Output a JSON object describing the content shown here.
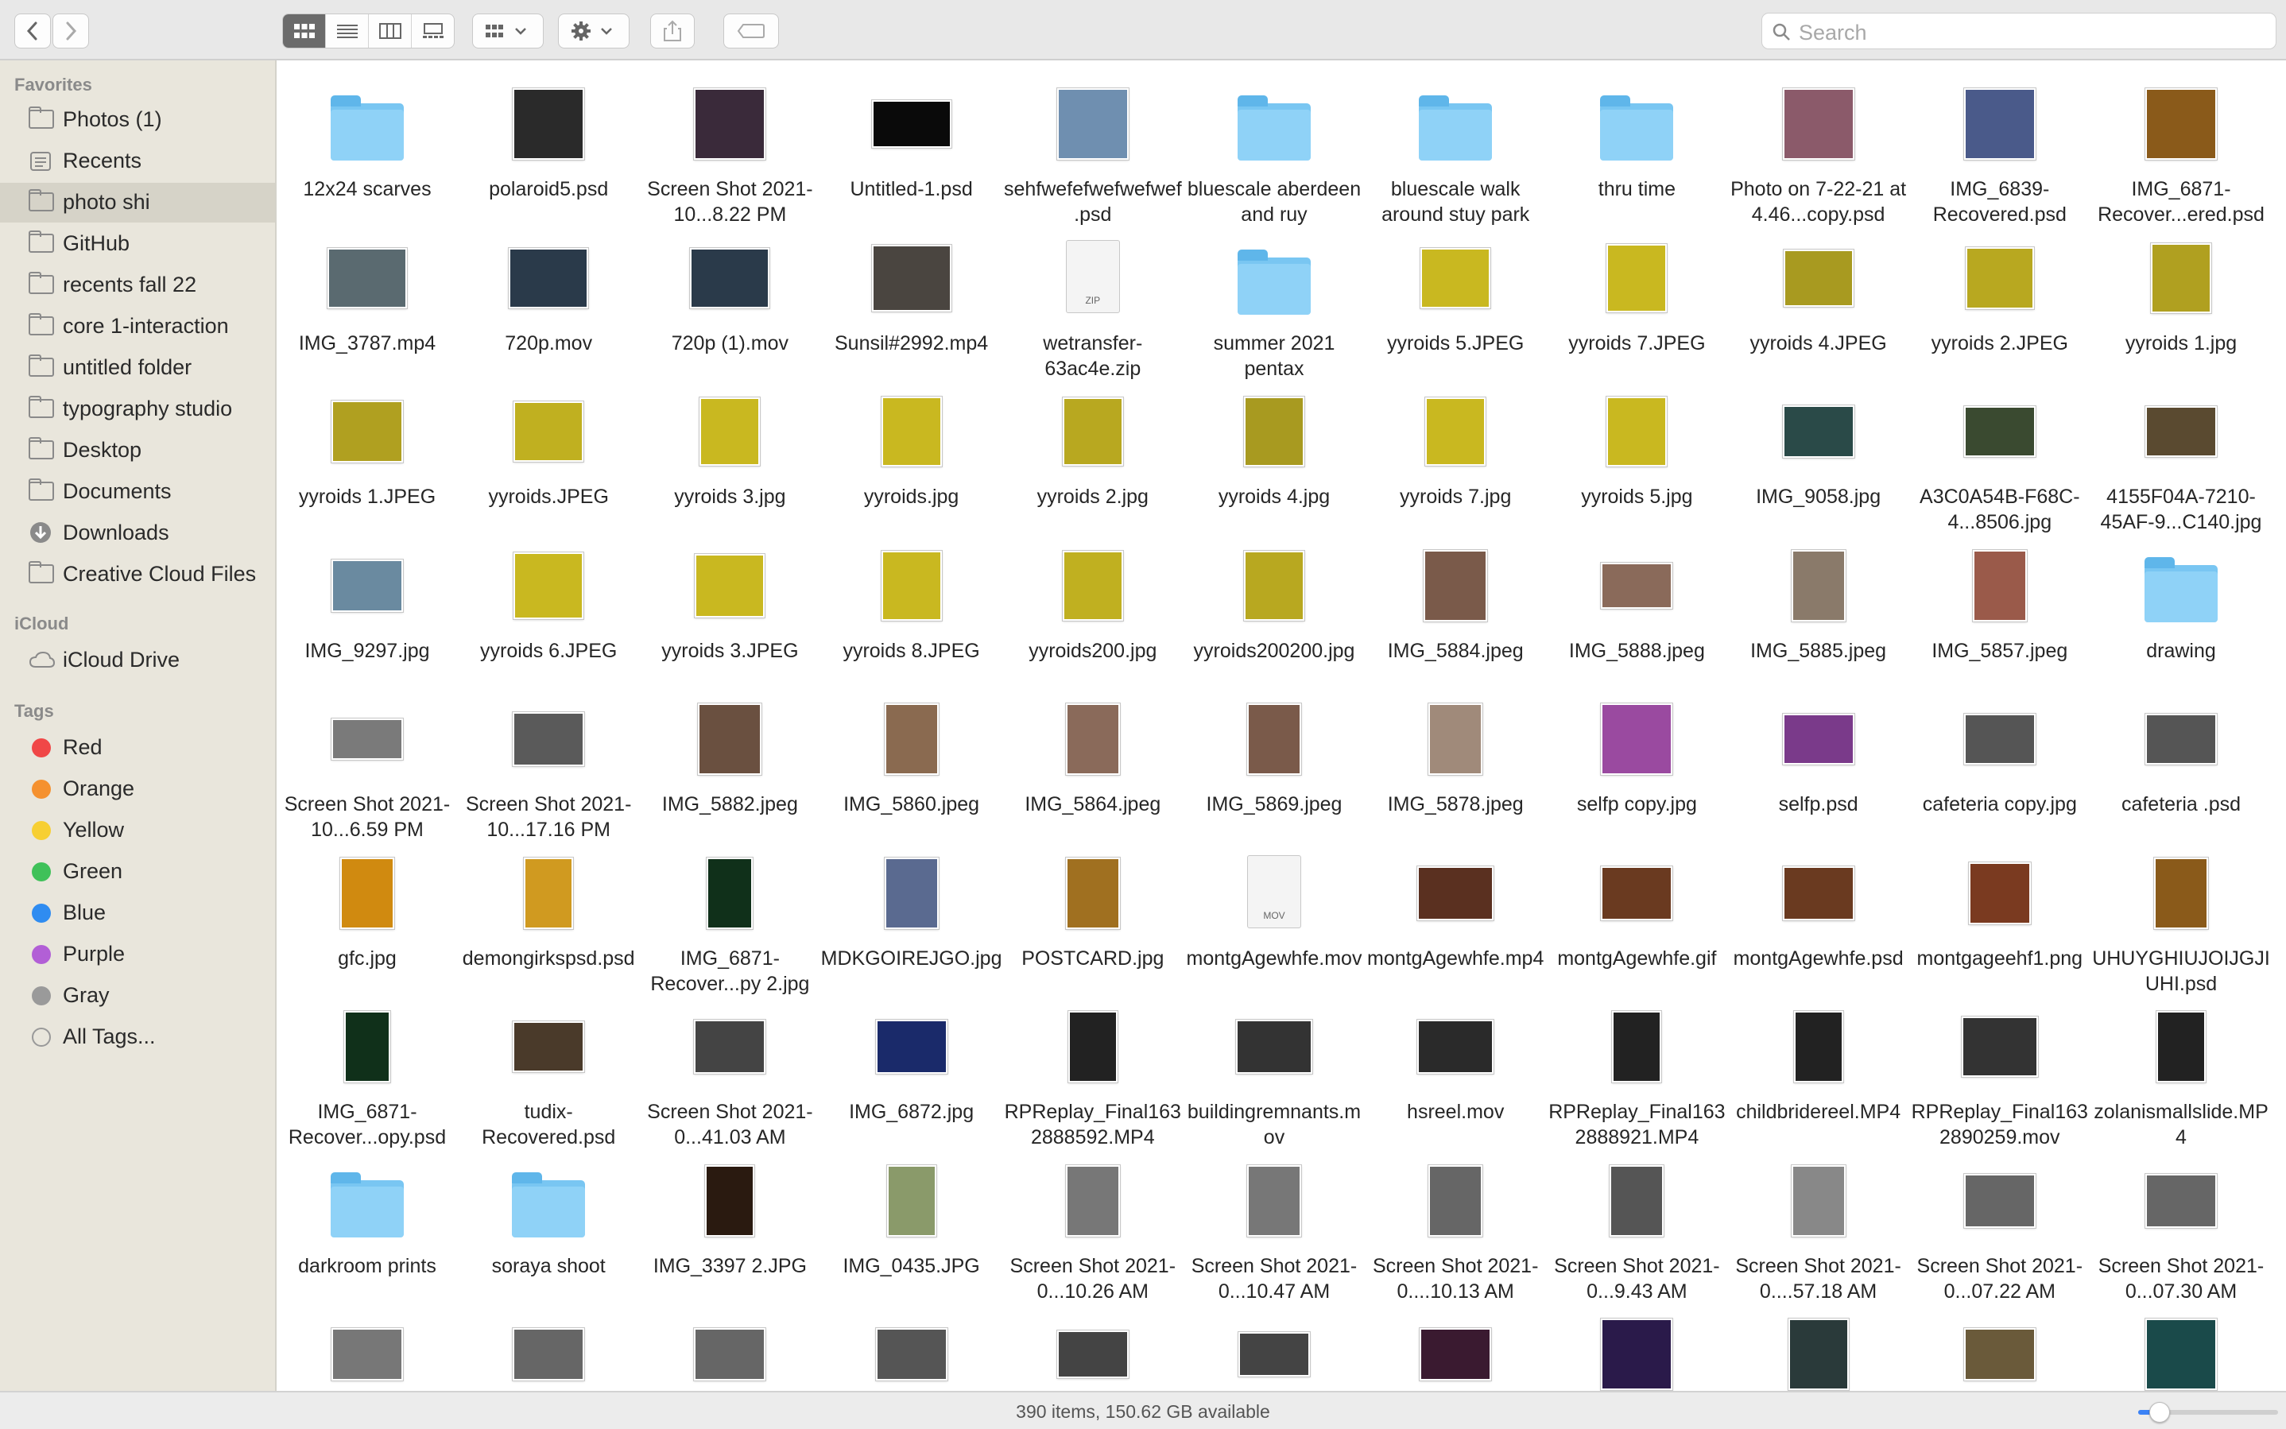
{
  "toolbar": {
    "search_placeholder": "Search",
    "view_modes": [
      "icon-view-icon",
      "list-view-icon",
      "column-view-icon",
      "gallery-view-icon"
    ],
    "active_view": 0
  },
  "sidebar": {
    "favorites_title": "Favorites",
    "favorites": [
      {
        "label": "Photos (1)",
        "icon": "folder-icon"
      },
      {
        "label": "Recents",
        "icon": "recents-icon"
      },
      {
        "label": "photo shi",
        "icon": "folder-icon",
        "selected": true
      },
      {
        "label": "GitHub",
        "icon": "folder-icon"
      },
      {
        "label": "recents fall 22",
        "icon": "folder-icon"
      },
      {
        "label": "core 1-interaction",
        "icon": "folder-icon"
      },
      {
        "label": "untitled folder",
        "icon": "folder-icon"
      },
      {
        "label": "typography studio",
        "icon": "folder-icon"
      },
      {
        "label": "Desktop",
        "icon": "folder-icon"
      },
      {
        "label": "Documents",
        "icon": "folder-icon"
      },
      {
        "label": "Downloads",
        "icon": "downloads-icon"
      },
      {
        "label": "Creative Cloud Files",
        "icon": "folder-icon"
      }
    ],
    "icloud_title": "iCloud",
    "icloud": [
      {
        "label": "iCloud Drive",
        "icon": "cloud-icon"
      }
    ],
    "tags_title": "Tags",
    "tags": [
      {
        "label": "Red",
        "color": "#f04747"
      },
      {
        "label": "Orange",
        "color": "#f5912f"
      },
      {
        "label": "Yellow",
        "color": "#f7cf33"
      },
      {
        "label": "Green",
        "color": "#3fc159"
      },
      {
        "label": "Blue",
        "color": "#2f8cf1"
      },
      {
        "label": "Purple",
        "color": "#b25fd6"
      },
      {
        "label": "Gray",
        "color": "#9a9a9a"
      },
      {
        "label": "All Tags...",
        "color": "#dddddd"
      }
    ]
  },
  "files": [
    [
      {
        "name": "12x24 scarves",
        "kind": "folder"
      },
      {
        "name": "polaroid5.psd",
        "kind": "image",
        "color": "#2a2a2a"
      },
      {
        "name": "Screen Shot 2021-10...8.22 PM",
        "kind": "image",
        "color": "#3a2a3a"
      },
      {
        "name": "Untitled-1.psd",
        "kind": "image",
        "color": "#0a0a0a",
        "w": 96,
        "h": 56
      },
      {
        "name": "sehfwefefwefwefwef.psd",
        "kind": "image",
        "color": "#6f8fb0"
      },
      {
        "name": "bluescale aberdeen and ruy",
        "kind": "folder"
      },
      {
        "name": "bluescale walk around stuy park",
        "kind": "folder"
      },
      {
        "name": "thru time",
        "kind": "folder"
      },
      {
        "name": "Photo on 7-22-21 at 4.46...copy.psd",
        "kind": "image",
        "color": "#8b5a6a"
      },
      {
        "name": "IMG_6839-Recovered.psd",
        "kind": "image",
        "color": "#4a5a8a"
      },
      {
        "name": "IMG_6871-Recover...ered.psd",
        "kind": "image",
        "color": "#8a5a1a"
      }
    ],
    [
      {
        "name": "IMG_3787.mp4",
        "kind": "image",
        "color": "#5a6a70",
        "w": 96,
        "h": 72
      },
      {
        "name": "720p.mov",
        "kind": "image",
        "color": "#2a3a4a",
        "w": 96,
        "h": 72
      },
      {
        "name": "720p (1).mov",
        "kind": "image",
        "color": "#2a3a4a",
        "w": 96,
        "h": 72
      },
      {
        "name": "Sunsil#2992.mp4",
        "kind": "image",
        "color": "#4a4540",
        "w": 96,
        "h": 80
      },
      {
        "name": "wetransfer-63ac4e.zip",
        "kind": "doc",
        "ext": "ZIP"
      },
      {
        "name": "summer 2021 pentax",
        "kind": "folder"
      },
      {
        "name": "yyroids 5.JPEG",
        "kind": "image",
        "color": "#c9b820",
        "w": 84,
        "h": 72
      },
      {
        "name": "yyroids 7.JPEG",
        "kind": "image",
        "color": "#c9b820",
        "w": 72,
        "h": 82
      },
      {
        "name": "yyroids 4.JPEG",
        "kind": "image",
        "color": "#a89a20",
        "w": 84,
        "h": 68
      },
      {
        "name": "yyroids 2.JPEG",
        "kind": "image",
        "color": "#b8a820",
        "w": 82,
        "h": 74
      },
      {
        "name": "yyroids 1.jpg",
        "kind": "image",
        "color": "#b0a020",
        "w": 72,
        "h": 84
      }
    ],
    [
      {
        "name": "yyroids 1.JPEG",
        "kind": "image",
        "color": "#b0a020",
        "w": 86,
        "h": 74
      },
      {
        "name": "yyroids.JPEG",
        "kind": "image",
        "color": "#c0b020",
        "w": 84,
        "h": 72
      },
      {
        "name": "yyroids 3.jpg",
        "kind": "image",
        "color": "#c9b820",
        "w": 72,
        "h": 82
      },
      {
        "name": "yyroids.jpg",
        "kind": "image",
        "color": "#c9b820",
        "w": 72,
        "h": 84
      },
      {
        "name": "yyroids 2.jpg",
        "kind": "image",
        "color": "#b8a820",
        "w": 72,
        "h": 82
      },
      {
        "name": "yyroids 4.jpg",
        "kind": "image",
        "color": "#a89a20",
        "w": 72,
        "h": 84
      },
      {
        "name": "yyroids 7.jpg",
        "kind": "image",
        "color": "#c9b820",
        "w": 72,
        "h": 82
      },
      {
        "name": "yyroids 5.jpg",
        "kind": "image",
        "color": "#c9b820",
        "w": 72,
        "h": 84
      },
      {
        "name": "IMG_9058.jpg",
        "kind": "image",
        "color": "#2a4a48",
        "w": 86,
        "h": 62
      },
      {
        "name": "A3C0A54B-F68C-4...8506.jpg",
        "kind": "image",
        "color": "#3a4a30",
        "w": 86,
        "h": 60
      },
      {
        "name": "4155F04A-7210-45AF-9...C140.jpg",
        "kind": "image",
        "color": "#5a4a30",
        "w": 86,
        "h": 60
      }
    ],
    [
      {
        "name": "IMG_9297.jpg",
        "kind": "image",
        "color": "#6a8aa0",
        "w": 86,
        "h": 62
      },
      {
        "name": "yyroids 6.JPEG",
        "kind": "image",
        "color": "#c9b820",
        "w": 84,
        "h": 80
      },
      {
        "name": "yyroids 3.JPEG",
        "kind": "image",
        "color": "#c9b820",
        "w": 84,
        "h": 76
      },
      {
        "name": "yyroids 8.JPEG",
        "kind": "image",
        "color": "#c9b820",
        "w": 72,
        "h": 84
      },
      {
        "name": "yyroids200.jpg",
        "kind": "image",
        "color": "#c0b020",
        "w": 72,
        "h": 84
      },
      {
        "name": "yyroids200200.jpg",
        "kind": "image",
        "color": "#b8a820",
        "w": 72,
        "h": 84
      },
      {
        "name": "IMG_5884.jpeg",
        "kind": "image",
        "color": "#7a5a4a",
        "w": 76,
        "h": 86
      },
      {
        "name": "IMG_5888.jpeg",
        "kind": "image",
        "color": "#8a6a5a",
        "w": 86,
        "h": 54
      },
      {
        "name": "IMG_5885.jpeg",
        "kind": "image",
        "color": "#8a7a6a",
        "w": 64,
        "h": 86
      },
      {
        "name": "IMG_5857.jpeg",
        "kind": "image",
        "color": "#9a5a4a",
        "w": 64,
        "h": 86
      },
      {
        "name": "drawing",
        "kind": "folder"
      }
    ],
    [
      {
        "name": "Screen Shot 2021-10...6.59 PM",
        "kind": "image",
        "color": "#7a7a7a",
        "w": 86,
        "h": 48
      },
      {
        "name": "Screen Shot 2021-10...17.16 PM",
        "kind": "image",
        "color": "#5a5a5a",
        "w": 86,
        "h": 64
      },
      {
        "name": "IMG_5882.jpeg",
        "kind": "image",
        "color": "#6a5040",
        "w": 76,
        "h": 86
      },
      {
        "name": "IMG_5860.jpeg",
        "kind": "image",
        "color": "#8a6a50",
        "w": 64,
        "h": 86
      },
      {
        "name": "IMG_5864.jpeg",
        "kind": "image",
        "color": "#8a6a5a",
        "w": 64,
        "h": 86
      },
      {
        "name": "IMG_5869.jpeg",
        "kind": "image",
        "color": "#7a5a4a",
        "w": 64,
        "h": 86
      },
      {
        "name": "IMG_5878.jpeg",
        "kind": "image",
        "color": "#a08a7a",
        "w": 64,
        "h": 86
      },
      {
        "name": "selfp copy.jpg",
        "kind": "image",
        "color": "#9a4aa0",
        "w": 86,
        "h": 86
      },
      {
        "name": "selfp.psd",
        "kind": "image",
        "color": "#7a3a8a",
        "w": 86,
        "h": 60
      },
      {
        "name": "cafeteria copy.jpg",
        "kind": "image",
        "color": "#555",
        "w": 86,
        "h": 60
      },
      {
        "name": "cafeteria .psd",
        "kind": "image",
        "color": "#555",
        "w": 86,
        "h": 60
      }
    ],
    [
      {
        "name": "gfc.jpg",
        "kind": "image",
        "color": "#d08a10",
        "w": 64,
        "h": 86
      },
      {
        "name": "demongirkspsd.psd",
        "kind": "image",
        "color": "#d09a20",
        "w": 58,
        "h": 86
      },
      {
        "name": "IMG_6871-Recover...py 2.jpg",
        "kind": "image",
        "color": "#10301a",
        "w": 54,
        "h": 86
      },
      {
        "name": "MDKGOIREJGO.jpg",
        "kind": "image",
        "color": "#5a6a90",
        "w": 64,
        "h": 86
      },
      {
        "name": "POSTCARD.jpg",
        "kind": "image",
        "color": "#a07020",
        "w": 64,
        "h": 86
      },
      {
        "name": "montgAgewhfe.mov",
        "kind": "doc",
        "ext": "MOV"
      },
      {
        "name": "montgAgewhfe.mp4",
        "kind": "image",
        "color": "#5a3020",
        "w": 92,
        "h": 64
      },
      {
        "name": "montgAgewhfe.gif",
        "kind": "image",
        "color": "#6a3a20",
        "w": 86,
        "h": 64
      },
      {
        "name": "montgAgewhfe.psd",
        "kind": "image",
        "color": "#6a3a20",
        "w": 86,
        "h": 64
      },
      {
        "name": "montgageehf1.png",
        "kind": "image",
        "color": "#7a3a20",
        "w": 74,
        "h": 74
      },
      {
        "name": "UHUYGHIUJOIJGJIUHI.psd",
        "kind": "image",
        "color": "#8a5a1a",
        "w": 64,
        "h": 86
      }
    ],
    [
      {
        "name": "IMG_6871-Recover...opy.psd",
        "kind": "image",
        "color": "#10301a",
        "w": 54,
        "h": 86
      },
      {
        "name": "tudix-Recovered.psd",
        "kind": "image",
        "color": "#4a3a2a",
        "w": 86,
        "h": 60
      },
      {
        "name": "Screen Shot 2021-0...41.03 AM",
        "kind": "image",
        "color": "#444",
        "w": 86,
        "h": 64
      },
      {
        "name": "IMG_6872.jpg",
        "kind": "image",
        "color": "#1a2a6a",
        "w": 86,
        "h": 64
      },
      {
        "name": "RPReplay_Final1632888592.MP4",
        "kind": "image",
        "color": "#222",
        "w": 58,
        "h": 86
      },
      {
        "name": "buildingremnants.mov",
        "kind": "image",
        "color": "#333",
        "w": 92,
        "h": 64
      },
      {
        "name": "hsreel.mov",
        "kind": "image",
        "color": "#2a2a2a",
        "w": 92,
        "h": 64
      },
      {
        "name": "RPReplay_Final1632888921.MP4",
        "kind": "image",
        "color": "#222",
        "w": 58,
        "h": 86
      },
      {
        "name": "childbridereel.MP4",
        "kind": "image",
        "color": "#222",
        "w": 58,
        "h": 86
      },
      {
        "name": "RPReplay_Final1632890259.mov",
        "kind": "image",
        "color": "#333",
        "w": 92,
        "h": 72
      },
      {
        "name": "zolanismallslide.MP4",
        "kind": "image",
        "color": "#222",
        "w": 58,
        "h": 86
      }
    ],
    [
      {
        "name": "darkroom prints",
        "kind": "folder"
      },
      {
        "name": "soraya shoot",
        "kind": "folder"
      },
      {
        "name": "IMG_3397 2.JPG",
        "kind": "image",
        "color": "#2a1a10",
        "w": 58,
        "h": 86
      },
      {
        "name": "IMG_0435.JPG",
        "kind": "image",
        "color": "#8a9a6a",
        "w": 58,
        "h": 86
      },
      {
        "name": "Screen Shot 2021-0...10.26 AM",
        "kind": "image",
        "color": "#777",
        "w": 64,
        "h": 86
      },
      {
        "name": "Screen Shot 2021-0...10.47 AM",
        "kind": "image",
        "color": "#777",
        "w": 64,
        "h": 86
      },
      {
        "name": "Screen Shot 2021-0....10.13 AM",
        "kind": "image",
        "color": "#666",
        "w": 64,
        "h": 86
      },
      {
        "name": "Screen Shot 2021-0...9.43 AM",
        "kind": "image",
        "color": "#555",
        "w": 64,
        "h": 86
      },
      {
        "name": "Screen Shot 2021-0....57.18 AM",
        "kind": "image",
        "color": "#888",
        "w": 64,
        "h": 86
      },
      {
        "name": "Screen Shot 2021-0...07.22 AM",
        "kind": "image",
        "color": "#666",
        "w": 86,
        "h": 64
      },
      {
        "name": "Screen Shot 2021-0...07.30 AM",
        "kind": "image",
        "color": "#666",
        "w": 86,
        "h": 64
      }
    ],
    [
      {
        "name": "",
        "kind": "image",
        "color": "#777",
        "w": 86,
        "h": 62
      },
      {
        "name": "",
        "kind": "image",
        "color": "#666",
        "w": 86,
        "h": 62
      },
      {
        "name": "",
        "kind": "image",
        "color": "#666",
        "w": 86,
        "h": 62
      },
      {
        "name": "",
        "kind": "image",
        "color": "#555",
        "w": 86,
        "h": 62
      },
      {
        "name": "",
        "kind": "image",
        "color": "#444",
        "w": 86,
        "h": 56
      },
      {
        "name": "",
        "kind": "image",
        "color": "#444",
        "w": 86,
        "h": 52
      },
      {
        "name": "",
        "kind": "image",
        "color": "#3a1a30",
        "w": 86,
        "h": 62
      },
      {
        "name": "",
        "kind": "image",
        "color": "#2a1a4a",
        "w": 86,
        "h": 86
      },
      {
        "name": "",
        "kind": "image",
        "color": "#2a3a3a",
        "w": 72,
        "h": 86
      },
      {
        "name": "",
        "kind": "image",
        "color": "#6a5a3a",
        "w": 86,
        "h": 62
      },
      {
        "name": "",
        "kind": "image",
        "color": "#1a4a4a",
        "w": 86,
        "h": 86
      }
    ]
  ],
  "status": {
    "text": "390 items, 150.62 GB available",
    "zoom_level": 0.15
  }
}
